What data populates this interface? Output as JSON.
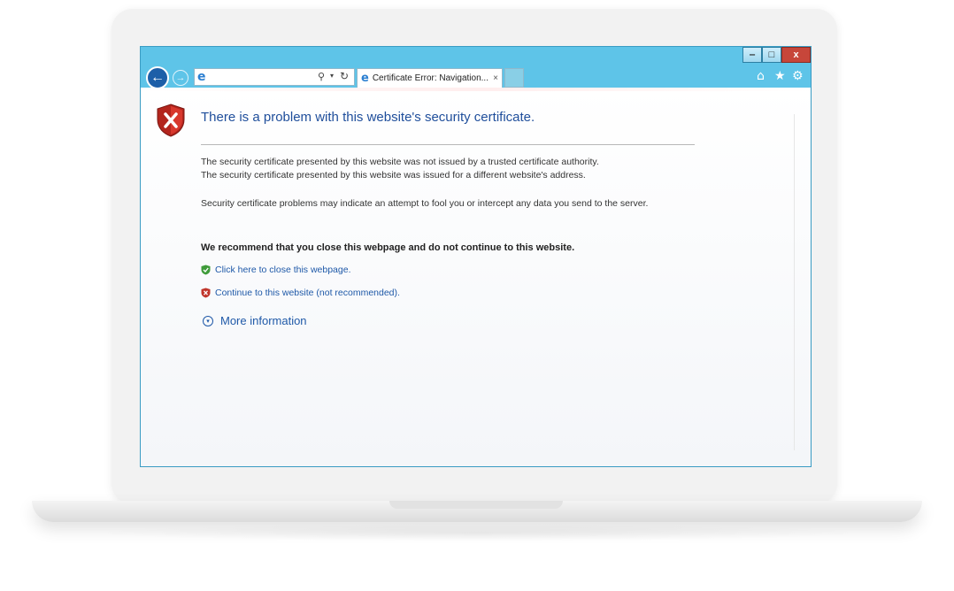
{
  "window": {
    "minimize_glyph": "‒",
    "maximize_glyph": "□",
    "close_glyph": "x"
  },
  "navbar": {
    "back_glyph": "←",
    "forward_glyph": "→",
    "address": {
      "value": "",
      "search_glyph": "⚲",
      "dropdown_glyph": "▾",
      "refresh_glyph": "↻"
    },
    "tab": {
      "title": "Certificate Error: Navigation...",
      "close_glyph": "×"
    },
    "icons": {
      "browser": "ie-icon",
      "home": "⌂",
      "favorites": "★",
      "tools": "⚙"
    }
  },
  "page": {
    "title": "There is a problem with this website's security certificate.",
    "paragraph1_line1": "The security certificate presented by this website was not issued by a trusted certificate authority.",
    "paragraph1_line2": "The security certificate presented by this website was issued for a different website's address.",
    "paragraph2": "Security certificate problems may indicate an attempt to fool you or intercept any data you send to the server.",
    "recommendation": "We recommend that you close this webpage and do not continue to this website.",
    "close_link": "Click here to close this webpage.",
    "continue_link": "Continue to this website (not recommended).",
    "more_info": "More information",
    "more_info_glyph": "▾"
  },
  "colors": {
    "titlebar": "#5ec4e8",
    "link": "#1f59a8",
    "title": "#1f4e9b",
    "close_button": "#c7463a"
  }
}
